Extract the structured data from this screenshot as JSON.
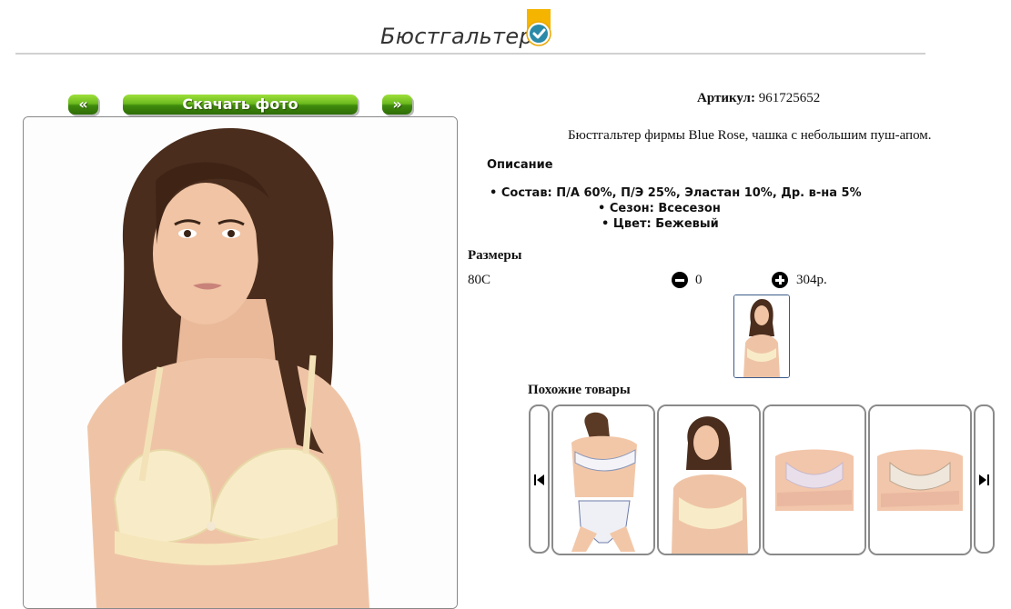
{
  "header": {
    "title": "Бюстгальтер",
    "badge_icon": "verified-check-badge-icon",
    "badge_colors": {
      "ribbon": "#f4b400",
      "check": "#2a8aa8"
    }
  },
  "gallery": {
    "prev_label": "«",
    "download_label": "Скачать фото",
    "next_label": "»",
    "button_color": "#5fae14"
  },
  "product": {
    "article_label": "Артикул:",
    "article_value": "961725652",
    "description": "Бюстгальтер фирмы Blue Rose, чашка с небольшим пуш-апом.",
    "details_heading": "Описание",
    "details": [
      "Состав: П/А 60%, П/Э 25%, Эластан 10%, Др. в-на 5%",
      "Сезон: Всесезон",
      "Цвет: Бежевый"
    ]
  },
  "sizes": {
    "heading": "Размеры",
    "rows": [
      {
        "size": "80C",
        "quantity": "0",
        "price": "304р."
      }
    ]
  },
  "similar": {
    "heading": "Похожие товары",
    "prev_icon": "skip-previous-icon",
    "next_icon": "skip-next-icon"
  }
}
